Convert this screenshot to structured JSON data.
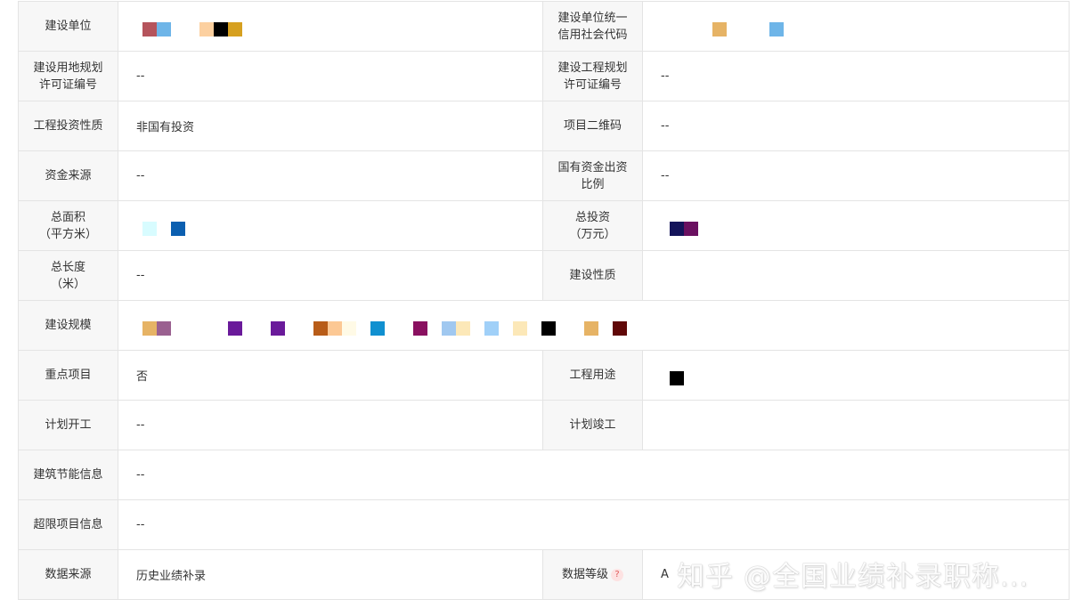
{
  "rows": [
    {
      "l1": "建设单位",
      "v1": "",
      "l2": "建设单位统一信用社会代码",
      "v2": ""
    },
    {
      "l1": "建设用地规划许可证编号",
      "v1": "--",
      "l2": "建设工程规划许可证编号",
      "v2": "--"
    },
    {
      "l1": "工程投资性质",
      "v1": "非国有投资",
      "l2": "项目二维码",
      "v2": "--"
    },
    {
      "l1": "资金来源",
      "v1": "--",
      "l2": "国有资金出资比例",
      "v2": "--"
    },
    {
      "l1": "总面积\n（平方米）",
      "v1": "",
      "l2": "总投资\n（万元）",
      "v2": ""
    },
    {
      "l1": "总长度\n（米）",
      "v1": "--",
      "l2": "建设性质",
      "v2": ""
    },
    {
      "l1": "建设规模",
      "v1": ""
    },
    {
      "l1": "重点项目",
      "v1": "否",
      "l2": "工程用途",
      "v2": ""
    },
    {
      "l1": "计划开工",
      "v1": "--",
      "l2": "计划竣工",
      "v2": ""
    },
    {
      "l1": "建筑节能信息",
      "v1": "--"
    },
    {
      "l1": "超限项目信息",
      "v1": "--"
    },
    {
      "l1": "数据来源",
      "v1": "历史业绩补录",
      "l2": "数据等级",
      "v2": "A"
    }
  ],
  "help_icon": {
    "glyph": "?",
    "color": "#e05a5a",
    "bg": "#fde2e2"
  },
  "watermark": "知乎 @全国业绩补录职称...",
  "redaction_colors": {
    "r0v1": [
      "#b5545c",
      "#6eb5e8",
      "#fcd0a0",
      "#000000",
      "#d6a020"
    ],
    "r0v2": [
      "#e6b365",
      "#6eb5e8"
    ],
    "r4v1": [
      "#d8fcff",
      "#0b5fb0"
    ],
    "r4v2": [
      "#14145a",
      "#6a1060"
    ],
    "r6v1": [
      "#e6b365",
      "#9a6090",
      "#6a1a9a",
      "#6a1a9a",
      "#b85c18",
      "#fcc894",
      "#fffae6",
      "#1090d0",
      "#8a1060",
      "#a0c8f0",
      "#fce8b8",
      "#a0d0f8",
      "#fce8b8",
      "#000000",
      "#e6b365",
      "#600808"
    ],
    "r7v2": [
      "#000000"
    ]
  }
}
